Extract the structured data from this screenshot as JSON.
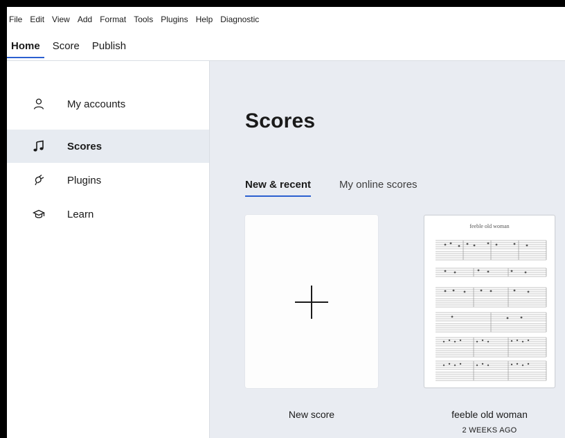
{
  "menu": [
    "File",
    "Edit",
    "View",
    "Add",
    "Format",
    "Tools",
    "Plugins",
    "Help",
    "Diagnostic"
  ],
  "workspace_tabs": [
    {
      "label": "Home",
      "active": true
    },
    {
      "label": "Score",
      "active": false
    },
    {
      "label": "Publish",
      "active": false
    }
  ],
  "sidebar": {
    "items": [
      {
        "label": "My accounts",
        "icon": "person-icon",
        "active": false
      },
      {
        "label": "Scores",
        "icon": "music-note-icon",
        "active": true
      },
      {
        "label": "Plugins",
        "icon": "plug-icon",
        "active": false
      },
      {
        "label": "Learn",
        "icon": "graduation-cap-icon",
        "active": false
      }
    ]
  },
  "main": {
    "title": "Scores",
    "tabs": [
      {
        "label": "New & recent",
        "active": true
      },
      {
        "label": "My online scores",
        "active": false
      }
    ],
    "scores": [
      {
        "name": "New score",
        "type": "new"
      },
      {
        "name": "feeble old woman",
        "modified": "2 WEEKS AGO",
        "thumbnail_title": "feeble old woman"
      }
    ]
  },
  "colors": {
    "accent": "#2b5fd0",
    "sidebar_active_bg": "#e7ebf1",
    "main_bg": "#e9ecf2"
  }
}
